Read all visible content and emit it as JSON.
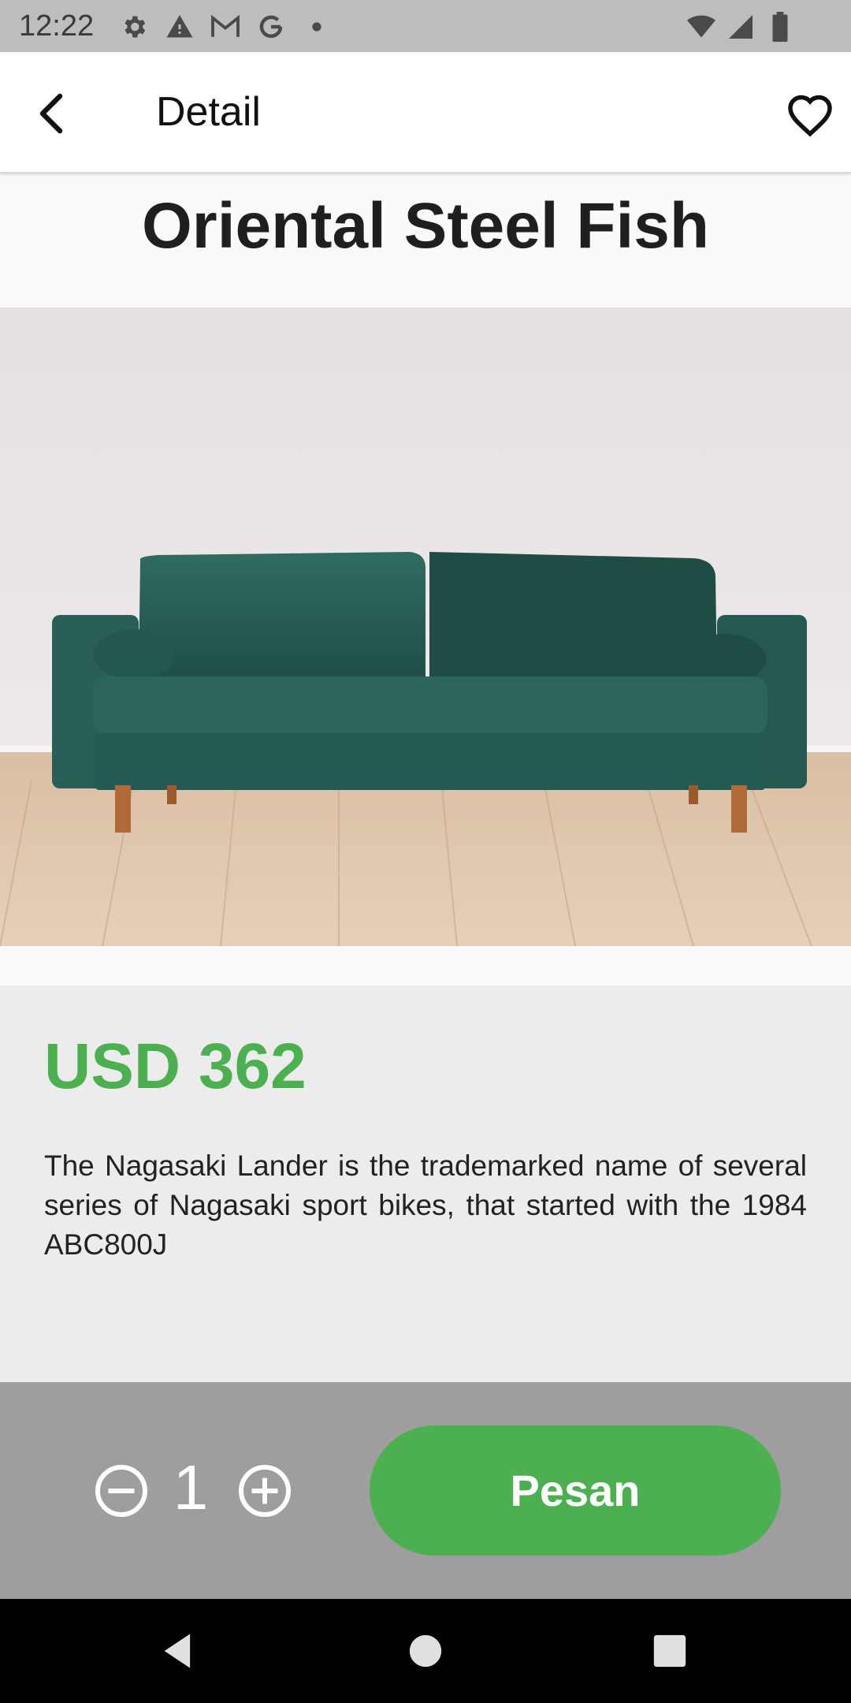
{
  "status_bar": {
    "time": "12:22",
    "icons_left": [
      "settings-icon",
      "warning-icon",
      "gmail-icon",
      "google-icon",
      "dot-icon"
    ],
    "icons_right": [
      "wifi-icon",
      "signal-icon",
      "battery-icon"
    ]
  },
  "app_bar": {
    "title": "Detail",
    "back_icon": "arrow-back-icon",
    "favorite_icon": "heart-outline-icon"
  },
  "product": {
    "name": "Oriental Steel Fish",
    "price": "USD 362",
    "description": "The Nagasaki Lander is the trademarked name of several series of Nagasaki sport bikes, that started with the 1984 ABC800J",
    "image_subject": "green velvet sofa"
  },
  "order": {
    "quantity": "1",
    "button_label": "Pesan"
  },
  "colors": {
    "accent": "#4caf50",
    "status_bar": "#bdbdbd",
    "bottom_bar": "#9e9e9e",
    "info_panel": "#ececec"
  },
  "nav_bar": {
    "buttons": [
      "nav-back-icon",
      "nav-home-icon",
      "nav-recents-icon"
    ]
  }
}
